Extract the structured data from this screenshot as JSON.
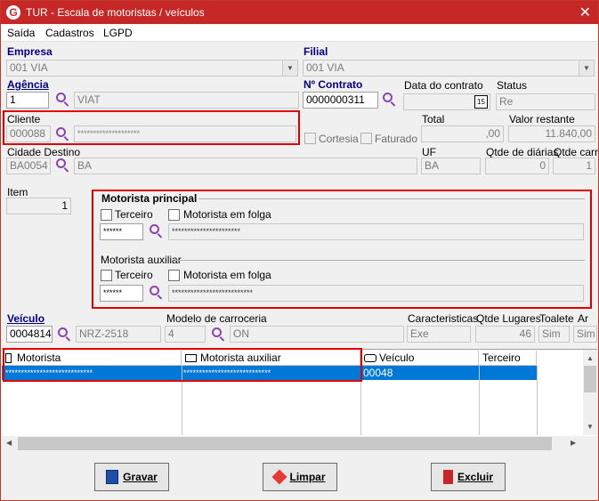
{
  "window": {
    "title": "TUR - Escala de motoristas / veículos",
    "close_glyph": "✕",
    "app_glyph": "G"
  },
  "menu": {
    "items": [
      "Saída",
      "Cadastros",
      "LGPD"
    ]
  },
  "empresa": {
    "label": "Empresa",
    "value": "001 VIA"
  },
  "filial": {
    "label": "Filial",
    "value": "001 VIA"
  },
  "agencia": {
    "label": "Agência",
    "code": "1",
    "name": "VIAT"
  },
  "contrato": {
    "label": "Nº Contrato",
    "value": "0000000311"
  },
  "data_contrato": {
    "label": "Data do contrato",
    "value": "",
    "cal_glyph": "15"
  },
  "status": {
    "label": "Status",
    "value": "Re"
  },
  "cliente": {
    "label": "Cliente",
    "code": "000088",
    "name": "********************"
  },
  "total": {
    "label": "Total",
    "value": ",00"
  },
  "valor_restante": {
    "label": "Valor restante",
    "value": "11.840,00"
  },
  "cortesia": {
    "label": "Cortesia"
  },
  "faturado": {
    "label": "Faturado"
  },
  "cidade_destino": {
    "label": "Cidade Destino",
    "code": "BA0054",
    "name": "BA"
  },
  "uf": {
    "label": "UF",
    "value": "BA"
  },
  "qtde_diarias": {
    "label": "Qtde de diárias",
    "value": "0"
  },
  "qtde_carro": {
    "label": "Qtde carro",
    "value": "1"
  },
  "item": {
    "label": "Item",
    "value": "1"
  },
  "motorista_principal": {
    "title": "Motorista principal",
    "terceiro": "Terceiro",
    "folga": "Motorista em folga",
    "code": "******",
    "name": "**********************"
  },
  "motorista_auxiliar": {
    "title": "Motorista auxiliar",
    "terceiro": "Terceiro",
    "folga": "Motorista em folga",
    "code": "******",
    "name": "**************************"
  },
  "veiculo": {
    "label": "Veículo",
    "code": "0004814",
    "placa": "NRZ-2518"
  },
  "modelo": {
    "label": "Modelo de carroceria",
    "code": "4",
    "name": "ON"
  },
  "caracteristicas": {
    "label": "Caracteristicas",
    "value": "Exe"
  },
  "qtd_lugares": {
    "label": "Qtde Lugares",
    "value": "46"
  },
  "toalete": {
    "label": "Toalete",
    "value": "Sim"
  },
  "ar": {
    "label": "Ar",
    "value": "Sim"
  },
  "grid": {
    "columns": [
      "Motorista",
      "Motorista auxiliar",
      "Veículo",
      "Terceiro"
    ],
    "row": {
      "motorista": "****************************",
      "auxiliar": "****************************",
      "veiculo": "00048",
      "terceiro": ""
    }
  },
  "buttons": {
    "gravar": "Gravar",
    "limpar": "Limpar",
    "excluir": "Excluir"
  },
  "colors": {
    "title_bar": "#c62828",
    "highlight_border": "#e00000",
    "selection": "#0078d7",
    "label_blue": "#000080"
  }
}
